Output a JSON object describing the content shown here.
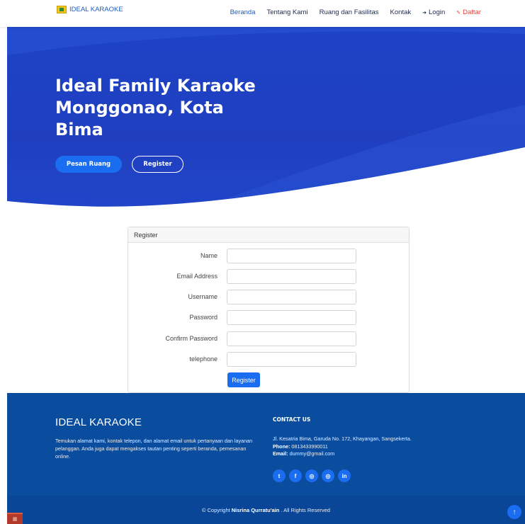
{
  "header": {
    "brand": "IDEAL KARAOKE",
    "nav": [
      {
        "label": "Beranda"
      },
      {
        "label": "Tentang Kami"
      },
      {
        "label": "Ruang dan Fasilitas"
      },
      {
        "label": "Kontak"
      },
      {
        "label": "Login",
        "icon": "login-icon"
      },
      {
        "label": "Daftar",
        "icon": "register-icon"
      }
    ]
  },
  "hero": {
    "title": "Ideal Family Karaoke Monggonao, Kota Bima",
    "primary_button": "Pesan Ruang",
    "secondary_button": "Register"
  },
  "form": {
    "header": "Register",
    "fields": [
      {
        "label": "Name",
        "value": ""
      },
      {
        "label": "Email Address",
        "value": ""
      },
      {
        "label": "Username",
        "value": ""
      },
      {
        "label": "Password",
        "value": ""
      },
      {
        "label": "Confirm Password",
        "value": ""
      },
      {
        "label": "telephone",
        "value": ""
      }
    ],
    "submit_label": "Register"
  },
  "footer": {
    "title": "IDEAL KARAOKE",
    "description": "Temukan alamat kami, kontak telepon, dan alamat email untuk pertanyaan dan layanan pelanggan. Anda juga dapat mengakses tautan penting seperti beranda, pemesanan online.",
    "contact_title": "CONTACT US",
    "address": "Jl. Kesatria Bima, Garuda No. 172, Khayangan, Sangsekerta.",
    "phone_label": "Phone:",
    "phone": "0813433990011",
    "email_label": "Email:",
    "email": "dummy@gmail.com",
    "socials": [
      "twitter-icon",
      "facebook-icon",
      "instagram-icon",
      "instagram-icon",
      "linkedin-icon"
    ]
  },
  "copyright": {
    "prefix": "© Copyright",
    "owner": "Nisrina Qurratu'ain",
    "suffix": ". All Rights Reserved"
  },
  "colors": {
    "brand_blue": "#1e43c6",
    "button_blue": "#1a6cf0",
    "footer_blue": "#0a4d9f",
    "daftar_red": "#e0443a"
  }
}
